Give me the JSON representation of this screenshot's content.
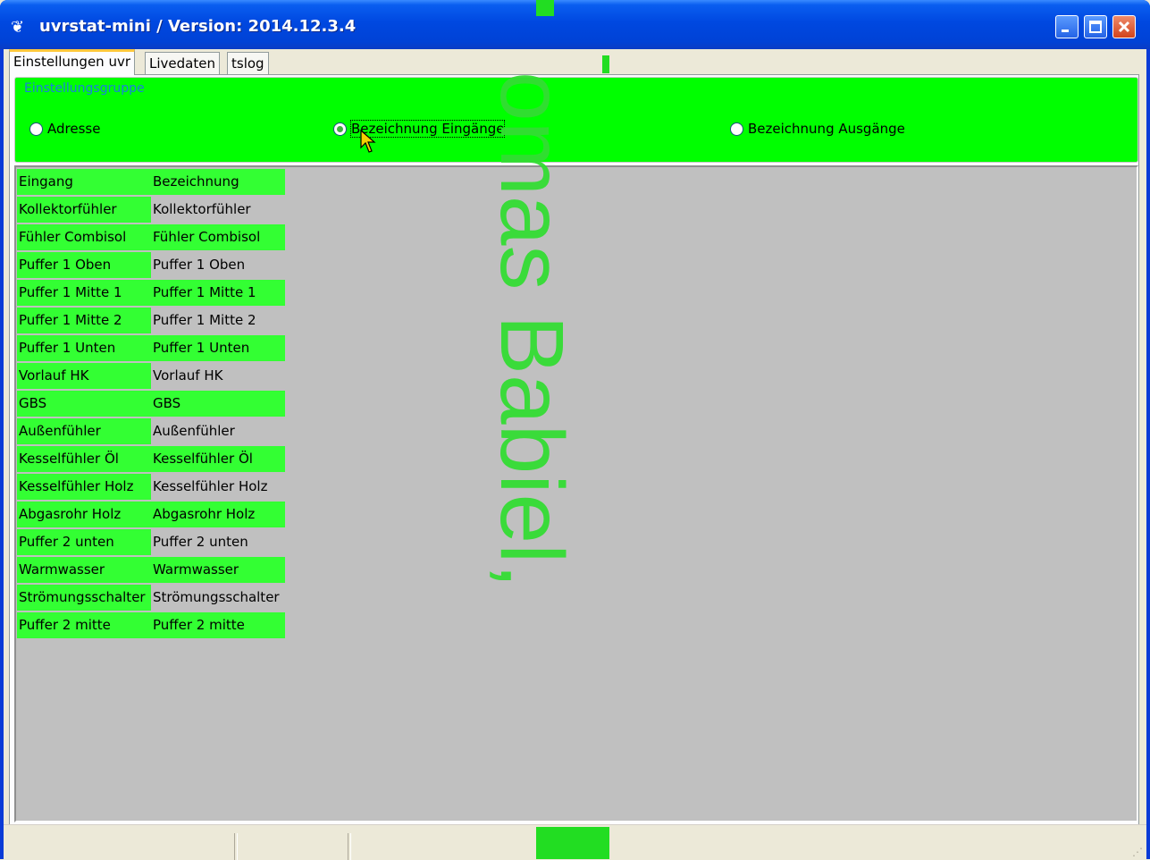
{
  "window": {
    "title": "uvrstat-mini / Version: 2014.12.3.4",
    "title_bar_color": "#0048e0"
  },
  "tabs": [
    {
      "label": "Einstellungen uvr",
      "active": true
    },
    {
      "label": "Livedaten",
      "active": false
    },
    {
      "label": "tslog",
      "active": false
    }
  ],
  "group": {
    "legend": "Einstellungsgruppe",
    "background": "#00ff00",
    "options": [
      {
        "label": "Adresse",
        "checked": false
      },
      {
        "label": "Bezeichnung Eingänge",
        "checked": true
      },
      {
        "label": "Bezeichnung Ausgänge",
        "checked": false
      }
    ]
  },
  "grid": {
    "headers": [
      "Eingang",
      "Bezeichnung"
    ],
    "rows": [
      [
        "Kollektorfühler",
        "Kollektorfühler"
      ],
      [
        "Fühler Combisol",
        "Fühler Combisol"
      ],
      [
        "Puffer 1 Oben",
        "Puffer 1 Oben"
      ],
      [
        "Puffer 1 Mitte 1",
        "Puffer 1 Mitte 1"
      ],
      [
        "Puffer 1 Mitte 2",
        "Puffer 1 Mitte 2"
      ],
      [
        "Puffer 1 Unten",
        "Puffer 1 Unten"
      ],
      [
        "Vorlauf HK",
        "Vorlauf HK"
      ],
      [
        "GBS",
        "GBS"
      ],
      [
        "Außenfühler",
        "Außenfühler"
      ],
      [
        "Kesselfühler Öl",
        "Kesselfühler Öl"
      ],
      [
        "Kesselfühler Holz",
        "Kesselfühler Holz"
      ],
      [
        "Abgasrohr Holz",
        "Abgasrohr Holz"
      ],
      [
        "Puffer 2 unten",
        "Puffer 2 unten"
      ],
      [
        "Warmwasser",
        "Warmwasser"
      ],
      [
        "Strömungsschalter",
        "Strömungsschalter"
      ],
      [
        "Puffer 2 mitte",
        "Puffer 2 mitte"
      ]
    ],
    "cell_color": "#33ff33",
    "grid_background": "#c0c0c0"
  },
  "watermark": {
    "text": "omas Babiel,",
    "color": "#33dd33"
  }
}
